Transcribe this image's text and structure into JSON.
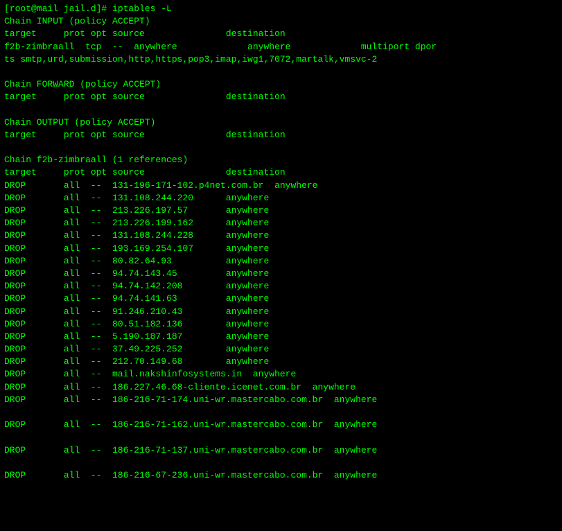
{
  "terminal": {
    "prompt": "[root@mail jail.d]# ",
    "command": "iptables -L",
    "lines": [
      {
        "type": "prompt_cmd",
        "content": "[root@mail jail.d]# iptables -L"
      },
      {
        "type": "section",
        "content": "Chain INPUT (policy ACCEPT)"
      },
      {
        "type": "colheader",
        "content": "target     prot opt source               destination"
      },
      {
        "type": "data",
        "content": "f2b-zimbraall  tcp  --  anywhere             anywhere             multiport dpor"
      },
      {
        "type": "data",
        "content": "ts smtp,urd,submission,http,https,pop3,imap,iwg1,7072,martalk,vmsvc-2"
      },
      {
        "type": "empty"
      },
      {
        "type": "section",
        "content": "Chain FORWARD (policy ACCEPT)"
      },
      {
        "type": "colheader",
        "content": "target     prot opt source               destination"
      },
      {
        "type": "empty"
      },
      {
        "type": "section",
        "content": "Chain OUTPUT (policy ACCEPT)"
      },
      {
        "type": "colheader",
        "content": "target     prot opt source               destination"
      },
      {
        "type": "empty"
      },
      {
        "type": "section",
        "content": "Chain f2b-zimbraall (1 references)"
      },
      {
        "type": "colheader",
        "content": "target     prot opt source               destination"
      },
      {
        "type": "data",
        "content": "DROP       all  --  131-196-171-102.p4net.com.br  anywhere"
      },
      {
        "type": "data",
        "content": "DROP       all  --  131.108.244.220      anywhere"
      },
      {
        "type": "data",
        "content": "DROP       all  --  213.226.197.57       anywhere"
      },
      {
        "type": "data",
        "content": "DROP       all  --  213.226.199.162      anywhere"
      },
      {
        "type": "data",
        "content": "DROP       all  --  131.108.244.228      anywhere"
      },
      {
        "type": "data",
        "content": "DROP       all  --  193.169.254.107      anywhere"
      },
      {
        "type": "data",
        "content": "DROP       all  --  80.82.64.93          anywhere"
      },
      {
        "type": "data",
        "content": "DROP       all  --  94.74.143.45         anywhere"
      },
      {
        "type": "data",
        "content": "DROP       all  --  94.74.142.208        anywhere"
      },
      {
        "type": "data",
        "content": "DROP       all  --  94.74.141.63         anywhere"
      },
      {
        "type": "data",
        "content": "DROP       all  --  91.246.210.43        anywhere"
      },
      {
        "type": "data",
        "content": "DROP       all  --  80.51.182.136        anywhere"
      },
      {
        "type": "data",
        "content": "DROP       all  --  5.190.187.187        anywhere"
      },
      {
        "type": "data",
        "content": "DROP       all  --  37.49.225.252        anywhere"
      },
      {
        "type": "data",
        "content": "DROP       all  --  212.70.149.68        anywhere"
      },
      {
        "type": "data",
        "content": "DROP       all  --  mail.nakshinfosystems.in  anywhere"
      },
      {
        "type": "data",
        "content": "DROP       all  --  186.227.46.68-cliente.icenet.com.br  anywhere"
      },
      {
        "type": "data",
        "content": "DROP       all  --  186-216-71-174.uni-wr.mastercabo.com.br  anywhere"
      },
      {
        "type": "empty"
      },
      {
        "type": "data",
        "content": "DROP       all  --  186-216-71-162.uni-wr.mastercabo.com.br  anywhere"
      },
      {
        "type": "empty"
      },
      {
        "type": "data",
        "content": "DROP       all  --  186-216-71-137.uni-wr.mastercabo.com.br  anywhere"
      },
      {
        "type": "empty"
      },
      {
        "type": "data",
        "content": "DROP       all  --  186-216-67-236.uni-wr.mastercabo.com.br  anywhere"
      }
    ]
  }
}
